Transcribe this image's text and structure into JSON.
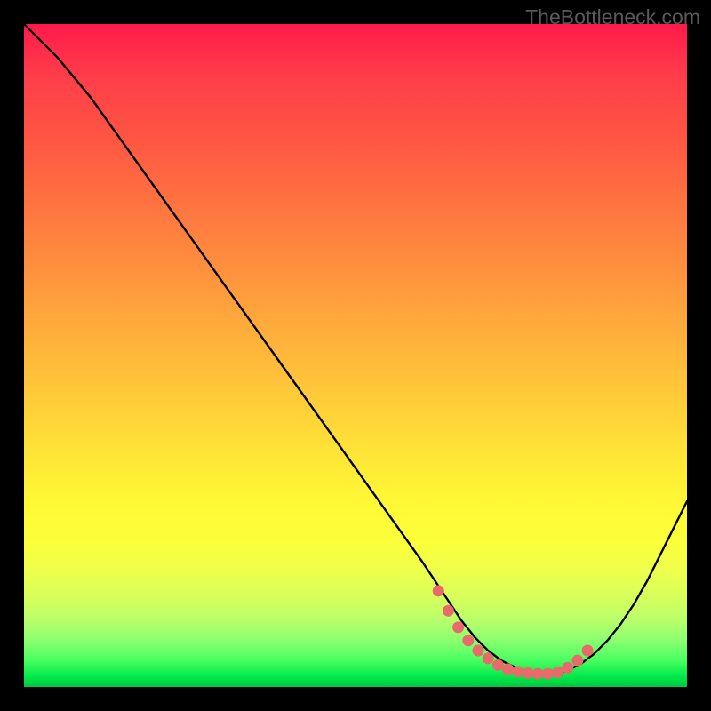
{
  "watermark": "TheBottleneck.com",
  "chart_data": {
    "type": "line",
    "title": "",
    "xlabel": "",
    "ylabel": "",
    "xlim": [
      0,
      100
    ],
    "ylim": [
      0,
      100
    ],
    "grid": false,
    "series": [
      {
        "name": "curve",
        "x": [
          0,
          5,
          10,
          15,
          20,
          25,
          30,
          35,
          40,
          45,
          50,
          55,
          60,
          62,
          64,
          66,
          68,
          70,
          72,
          74,
          76,
          78,
          80,
          82,
          84,
          86,
          88,
          90,
          92,
          94,
          96,
          98,
          100
        ],
        "values": [
          100,
          95,
          89,
          82,
          75,
          68,
          61,
          54,
          47,
          40,
          33,
          26,
          19,
          16,
          13,
          10,
          7.5,
          5.5,
          4,
          3,
          2.3,
          2,
          2,
          2.5,
          3.5,
          5,
          7,
          9.5,
          12.5,
          16,
          20,
          24,
          28
        ]
      },
      {
        "name": "marker-dots",
        "x": [
          62.5,
          64,
          65.5,
          67,
          68.5,
          70,
          71.5,
          73,
          74.5,
          76,
          77.5,
          79,
          80.5,
          82,
          83.5,
          85
        ],
        "values": [
          14.5,
          11.5,
          9,
          7,
          5.5,
          4.3,
          3.3,
          2.7,
          2.3,
          2.1,
          2.0,
          2.0,
          2.2,
          2.9,
          4.0,
          5.5
        ]
      }
    ],
    "annotations": [],
    "colors": {
      "curve": "#000000",
      "markers": "#e86a6a",
      "gradient_top": "#ff1a4a",
      "gradient_bottom": "#00c840"
    }
  }
}
